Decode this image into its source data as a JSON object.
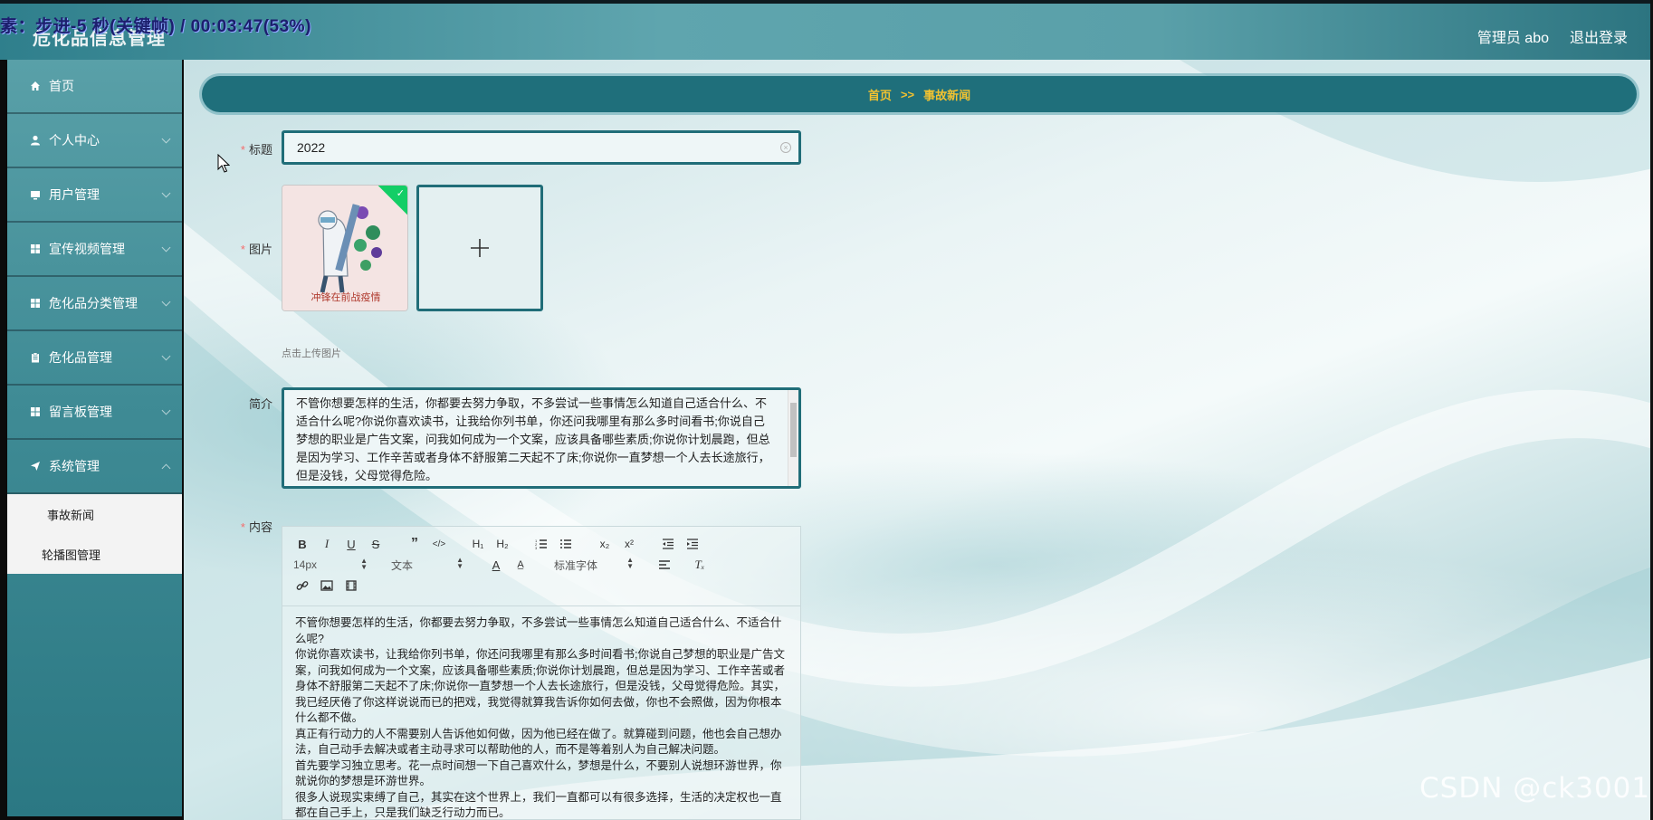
{
  "overlay": {
    "text": "素：步进-5 秒(关键帧) / 00:03:47(53%)"
  },
  "header": {
    "app_title": "危化品信息管理",
    "admin_label": "管理员 abo",
    "logout_label": "退出登录"
  },
  "sidebar": {
    "items": [
      {
        "label": "首页",
        "icon": "home-icon"
      },
      {
        "label": "个人中心",
        "icon": "user-icon"
      },
      {
        "label": "用户管理",
        "icon": "monitor-icon"
      },
      {
        "label": "宣传视频管理",
        "icon": "grid-icon"
      },
      {
        "label": "危化品分类管理",
        "icon": "grid-icon"
      },
      {
        "label": "危化品管理",
        "icon": "clipboard-icon"
      },
      {
        "label": "留言板管理",
        "icon": "grid-icon"
      },
      {
        "label": "系统管理",
        "icon": "send-icon"
      }
    ],
    "subitems": [
      "事故新闻",
      "轮播图管理"
    ]
  },
  "breadcrumb": {
    "home": "首页",
    "separator": ">>",
    "current": "事故新闻"
  },
  "form": {
    "title_label": "标题",
    "title_value": "2022",
    "image_label": "图片",
    "upload_hint": "点击上传图片",
    "desc_label": "简介",
    "desc_value": "不管你想要怎样的生活，你都要去努力争取，不多尝试一些事情怎么知道自己适合什么、不适合什么呢?你说你喜欢读书，让我给你列书单，你还问我哪里有那么多时间看书;你说自己梦想的职业是广告文案，问我如何成为一个文案，应该具备哪些素质;你说你计划晨跑，但总是因为学习、工作辛苦或者身体不舒服第二天起不了床;你说你一直梦想一个人去长途旅行，但是没钱，父母觉得危险。",
    "content_label": "内容",
    "image_caption": "冲锋在前战疫情"
  },
  "editor": {
    "font_size": "14px",
    "block_type": "文本",
    "font_family": "标准字体",
    "paragraphs": [
      "不管你想要怎样的生活，你都要去努力争取，不多尝试一些事情怎么知道自己适合什么、不适合什么呢?",
      "你说你喜欢读书，让我给你列书单，你还问我哪里有那么多时间看书;你说自己梦想的职业是广告文案，问我如何成为一个文案，应该具备哪些素质;你说你计划晨跑，但总是因为学习、工作辛苦或者身体不舒服第二天起不了床;你说你一直梦想一个人去长途旅行，但是没钱，父母觉得危险。其实，我已经厌倦了你这样说说而已的把戏，我觉得就算我告诉你如何去做，你也不会照做，因为你根本什么都不做。",
      "真正有行动力的人不需要别人告诉他如何做，因为他已经在做了。就算碰到问题，他也会自己想办法，自己动手去解决或者主动寻求可以帮助他的人，而不是等着别人为自己解决问题。",
      "首先要学习独立思考。花一点时间想一下自己喜欢什么，梦想是什么，不要别人说想环游世界，你就说你的梦想是环游世界。",
      "很多人说现实束缚了自己，其实在这个世界上，我们一直都可以有很多选择，生活的决定权也一直都在自己手上，只是我们缺乏行动力而已。"
    ]
  },
  "watermark": "CSDN @ck3001",
  "colors": {
    "accent": "#206d78",
    "breadcrumb_text": "#f2c230",
    "required": "#f56c6c"
  }
}
